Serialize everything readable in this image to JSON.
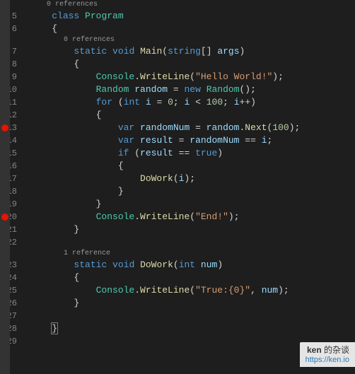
{
  "colors": {
    "bg": "#1e1e1e",
    "bpBar": "#333333",
    "bp": "#e51400"
  },
  "breakpoints": [
    13,
    20
  ],
  "codelens": {
    "refs0_a": "0 references",
    "refs0_b": "0 references",
    "refs1": "1 reference"
  },
  "lines": {
    "5": {
      "indent": 1,
      "tokens": [
        [
          "k",
          "class"
        ],
        [
          "p",
          " "
        ],
        [
          "c",
          "Program"
        ]
      ]
    },
    "6": {
      "indent": 1,
      "tokens": [
        [
          "p",
          "{"
        ]
      ]
    },
    "7": {
      "indent": 2,
      "tokens": [
        [
          "k",
          "static"
        ],
        [
          "p",
          " "
        ],
        [
          "k",
          "void"
        ],
        [
          "p",
          " "
        ],
        [
          "m",
          "Main"
        ],
        [
          "p",
          "("
        ],
        [
          "k",
          "string"
        ],
        [
          "p",
          "[] "
        ],
        [
          "v",
          "args"
        ],
        [
          "p",
          ")"
        ]
      ]
    },
    "8": {
      "indent": 2,
      "tokens": [
        [
          "p",
          "{"
        ]
      ]
    },
    "9": {
      "indent": 3,
      "tokens": [
        [
          "c",
          "Console"
        ],
        [
          "p",
          "."
        ],
        [
          "m",
          "WriteLine"
        ],
        [
          "p",
          "("
        ],
        [
          "s",
          "\"Hello World!\""
        ],
        [
          "p",
          ");"
        ]
      ]
    },
    "10": {
      "indent": 3,
      "tokens": [
        [
          "c",
          "Random"
        ],
        [
          "p",
          " "
        ],
        [
          "v",
          "random"
        ],
        [
          "p",
          " = "
        ],
        [
          "k",
          "new"
        ],
        [
          "p",
          " "
        ],
        [
          "c",
          "Random"
        ],
        [
          "p",
          "();"
        ]
      ]
    },
    "11": {
      "indent": 3,
      "tokens": [
        [
          "k",
          "for"
        ],
        [
          "p",
          " ("
        ],
        [
          "k",
          "int"
        ],
        [
          "p",
          " "
        ],
        [
          "v",
          "i"
        ],
        [
          "p",
          " = "
        ],
        [
          "n",
          "0"
        ],
        [
          "p",
          "; "
        ],
        [
          "v",
          "i"
        ],
        [
          "p",
          " < "
        ],
        [
          "n",
          "100"
        ],
        [
          "p",
          "; "
        ],
        [
          "v",
          "i"
        ],
        [
          "p",
          "++)"
        ]
      ]
    },
    "12": {
      "indent": 3,
      "tokens": [
        [
          "p",
          "{"
        ]
      ]
    },
    "13": {
      "indent": 4,
      "tokens": [
        [
          "k",
          "var"
        ],
        [
          "p",
          " "
        ],
        [
          "v",
          "randomNum"
        ],
        [
          "p",
          " = "
        ],
        [
          "v",
          "random"
        ],
        [
          "p",
          "."
        ],
        [
          "m",
          "Next"
        ],
        [
          "p",
          "("
        ],
        [
          "n",
          "100"
        ],
        [
          "p",
          ");"
        ]
      ]
    },
    "14": {
      "indent": 4,
      "tokens": [
        [
          "k",
          "var"
        ],
        [
          "p",
          " "
        ],
        [
          "v",
          "result"
        ],
        [
          "p",
          " = "
        ],
        [
          "v",
          "randomNum"
        ],
        [
          "p",
          " == "
        ],
        [
          "v",
          "i"
        ],
        [
          "p",
          ";"
        ]
      ]
    },
    "15": {
      "indent": 4,
      "tokens": [
        [
          "k",
          "if"
        ],
        [
          "p",
          " ("
        ],
        [
          "v",
          "result"
        ],
        [
          "p",
          " == "
        ],
        [
          "k",
          "true"
        ],
        [
          "p",
          ")"
        ]
      ]
    },
    "16": {
      "indent": 4,
      "tokens": [
        [
          "p",
          "{"
        ]
      ]
    },
    "17": {
      "indent": 5,
      "tokens": [
        [
          "m",
          "DoWork"
        ],
        [
          "p",
          "("
        ],
        [
          "v",
          "i"
        ],
        [
          "p",
          ");"
        ]
      ]
    },
    "18": {
      "indent": 4,
      "tokens": [
        [
          "p",
          "}"
        ]
      ]
    },
    "19": {
      "indent": 3,
      "tokens": [
        [
          "p",
          "}"
        ]
      ]
    },
    "20": {
      "indent": 3,
      "tokens": [
        [
          "c",
          "Console"
        ],
        [
          "p",
          "."
        ],
        [
          "m",
          "WriteLine"
        ],
        [
          "p",
          "("
        ],
        [
          "s",
          "\"End!\""
        ],
        [
          "p",
          ");"
        ]
      ]
    },
    "21": {
      "indent": 2,
      "tokens": [
        [
          "p",
          "}"
        ]
      ]
    },
    "22": {
      "indent": 0,
      "tokens": []
    },
    "23": {
      "indent": 2,
      "tokens": [
        [
          "k",
          "static"
        ],
        [
          "p",
          " "
        ],
        [
          "k",
          "void"
        ],
        [
          "p",
          " "
        ],
        [
          "m",
          "DoWork"
        ],
        [
          "p",
          "("
        ],
        [
          "k",
          "int"
        ],
        [
          "p",
          " "
        ],
        [
          "v",
          "num"
        ],
        [
          "p",
          ")"
        ]
      ]
    },
    "24": {
      "indent": 2,
      "tokens": [
        [
          "p",
          "{"
        ]
      ]
    },
    "25": {
      "indent": 3,
      "tokens": [
        [
          "c",
          "Console"
        ],
        [
          "p",
          "."
        ],
        [
          "m",
          "WriteLine"
        ],
        [
          "p",
          "("
        ],
        [
          "s",
          "\"True:{0}\""
        ],
        [
          "p",
          ", "
        ],
        [
          "v",
          "num"
        ],
        [
          "p",
          ");"
        ]
      ]
    },
    "26": {
      "indent": 2,
      "tokens": [
        [
          "p",
          "}"
        ]
      ]
    },
    "27": {
      "indent": 0,
      "tokens": []
    },
    "28": {
      "indent": 1,
      "tokens": [
        [
          "p",
          "}"
        ]
      ],
      "boxed": true
    },
    "29": {
      "indent": 0,
      "tokens": []
    }
  },
  "lineOrder": [
    "lensA",
    "5",
    "6",
    "lensB",
    "7",
    "8",
    "9",
    "10",
    "11",
    "12",
    "13",
    "14",
    "15",
    "16",
    "17",
    "18",
    "19",
    "20",
    "21",
    "22",
    "lensC",
    "23",
    "24",
    "25",
    "26",
    "27",
    "28",
    "29"
  ],
  "watermark": {
    "title_bold": "ken",
    "title_rest": " 的杂谈",
    "url": "https://ken.io"
  }
}
